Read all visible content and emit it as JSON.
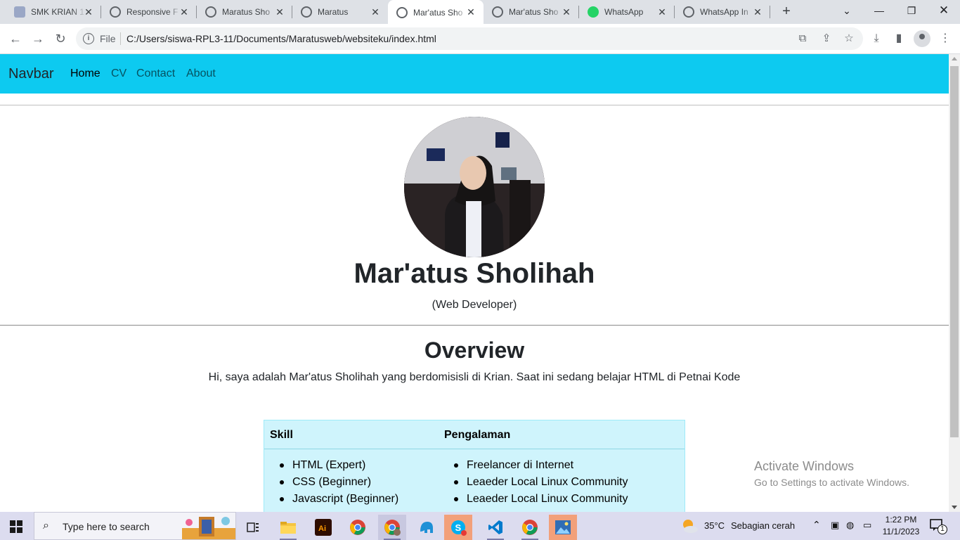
{
  "browser": {
    "tabs": [
      {
        "title": "SMK KRIAN 1",
        "active": false
      },
      {
        "title": "Responsive F",
        "active": false
      },
      {
        "title": "Maratus Sho",
        "active": false
      },
      {
        "title": "Maratus",
        "active": false
      },
      {
        "title": "Mar'atus Sho",
        "active": true
      },
      {
        "title": "Mar'atus Sho",
        "active": false
      },
      {
        "title": "WhatsApp",
        "active": false
      },
      {
        "title": "WhatsApp In",
        "active": false
      }
    ],
    "address": {
      "scheme_label": "File",
      "url": "C:/Users/siswa-RPL3-11/Documents/Maratusweb/websiteku/index.html"
    }
  },
  "page": {
    "navbar": {
      "brand": "Navbar",
      "links": [
        {
          "label": "Home",
          "active": true
        },
        {
          "label": "CV",
          "active": false
        },
        {
          "label": "Contact",
          "active": false
        },
        {
          "label": "About",
          "active": false
        }
      ],
      "color": "#0dcaf0"
    },
    "profile": {
      "name": "Mar'atus Sholihah",
      "role": "(Web Developer)"
    },
    "overview": {
      "title": "Overview",
      "text": "Hi, saya adalah Mar'atus Sholihah yang berdomisisli di Krian. Saat ini sedang belajar HTML di Petnai Kode"
    },
    "table": {
      "headers": [
        "Skill",
        "Pengalaman"
      ],
      "skills": [
        "HTML (Expert)",
        "CSS (Beginner)",
        "Javascript (Beginner)"
      ],
      "experience": [
        "Freelancer di Internet",
        "Leaeder Local Linux Community",
        "Leaeder Local Linux Community"
      ],
      "color": "#cff4fc"
    },
    "watermark": {
      "line1": "Activate Windows",
      "line2": "Go to Settings to activate Windows."
    }
  },
  "taskbar": {
    "search_placeholder": "Type here to search",
    "apps": [
      "task-view",
      "file-explorer",
      "adobe-illustrator",
      "chrome",
      "chrome-profile",
      "app-blue",
      "skype",
      "vscode",
      "chrome",
      "photos"
    ],
    "weather": {
      "temp": "35°C",
      "desc": "Sebagian cerah"
    },
    "time": "1:22 PM",
    "date": "11/1/2023",
    "notification_count": "1"
  }
}
